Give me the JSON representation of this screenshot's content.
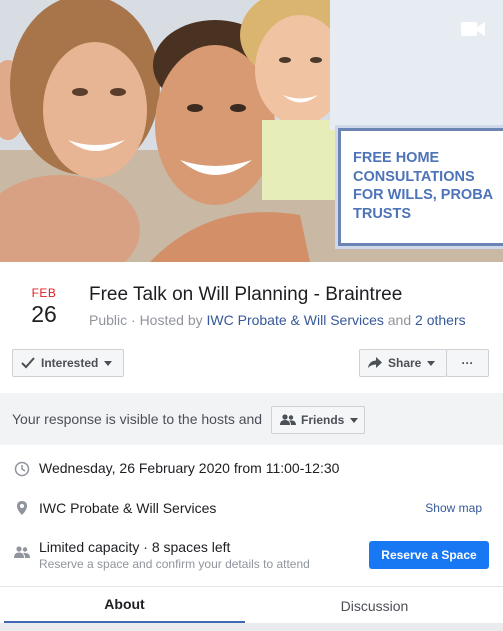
{
  "cover": {
    "promo_text": "FREE HOME\nCONSULTATIONS\nFOR WILLS, PROBA\nTRUSTS"
  },
  "event": {
    "month": "FEB",
    "day": "26",
    "title": "Free Talk on Will Planning - Braintree",
    "meta_prefix": "Public · Hosted by ",
    "host": "IWC Probate & Will Services",
    "meta_and": " and ",
    "others": "2 others"
  },
  "actions": {
    "interested_label": "Interested",
    "share_label": "Share",
    "more_label": "···"
  },
  "visibility": {
    "text": "Your response is visible to the hosts and",
    "audience_label": "Friends"
  },
  "details": {
    "datetime": "Wednesday, 26 February 2020 from 11:00-12:30",
    "location": "IWC Probate & Will Services",
    "show_map": "Show map",
    "capacity": "Limited capacity · 8 spaces left",
    "capacity_sub": "Reserve a space and confirm your details to attend",
    "reserve_label": "Reserve a Space"
  },
  "tabs": [
    {
      "label": "About",
      "active": true
    },
    {
      "label": "Discussion",
      "active": false
    }
  ],
  "colors": {
    "accent": "#1877f2",
    "link": "#365899",
    "date_month": "#e02020",
    "promo_text": "#4d73b8"
  }
}
